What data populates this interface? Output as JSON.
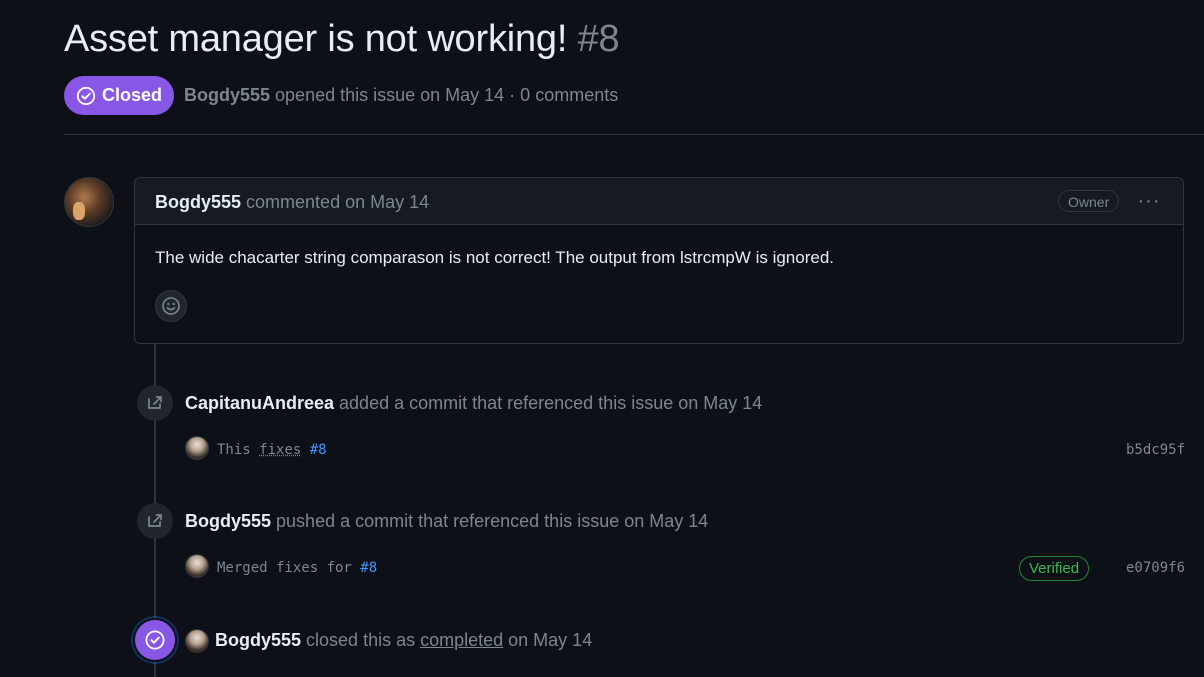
{
  "issue": {
    "title": "Asset manager is not working!",
    "number": "#8",
    "state_label": "Closed",
    "author": "Bogdy555",
    "meta_text": " opened this issue on May 14 · 0 comments"
  },
  "comment": {
    "author": "Bogdy555",
    "action": " commented on May 14",
    "owner_badge": "Owner",
    "more_label": "···",
    "body": "The wide chacarter string comparason is not correct! The output from lstrcmpW is ignored."
  },
  "events": [
    {
      "author": "CapitanuAndreea",
      "text": " added a commit that referenced this issue on May 14",
      "commit": {
        "msg_a": "This ",
        "msg_b": "fixes",
        "msg_c": " ",
        "ref": "#8",
        "sha": "b5dc95f"
      }
    },
    {
      "author": "Bogdy555",
      "text": " pushed a commit that referenced this issue on May 14",
      "commit": {
        "msg": "Merged fixes for ",
        "ref": "#8",
        "verified": "Verified",
        "sha": "e0709f6"
      }
    },
    {
      "author": "Bogdy555",
      "text_a": " closed this as ",
      "link": "completed",
      "text_b": " on May 14"
    }
  ],
  "colors": {
    "background": "#0d1117",
    "closed_purple": "#8957e5",
    "link_blue": "#4493f8",
    "verified_green": "#3fb950"
  },
  "icons": [
    "check-circle-icon",
    "smiley-icon",
    "cross-reference-icon",
    "kebab-menu-icon"
  ]
}
